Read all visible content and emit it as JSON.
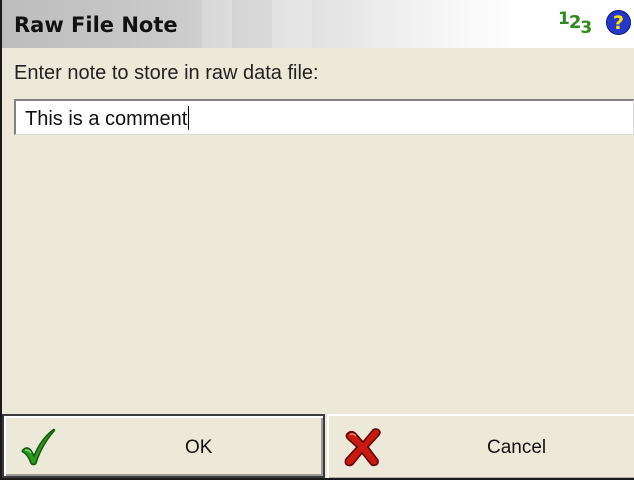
{
  "window": {
    "title": "Raw File Note",
    "numeric_mode_icon": {
      "glyphs": [
        "1",
        "2",
        "3"
      ],
      "color": "#2f8a1e"
    },
    "help_icon": {
      "glyph": "?",
      "color": "#2438c9"
    }
  },
  "form": {
    "prompt": "Enter note to store in raw data file:",
    "note_value": "This is a comment"
  },
  "buttons": {
    "ok": {
      "label": "OK",
      "icon": "green-checkmark-icon"
    },
    "cancel": {
      "label": "Cancel",
      "icon": "red-x-icon"
    }
  },
  "colors": {
    "background": "#ece9d8",
    "accept": "#2c9a1c",
    "reject": "#c81a12"
  }
}
